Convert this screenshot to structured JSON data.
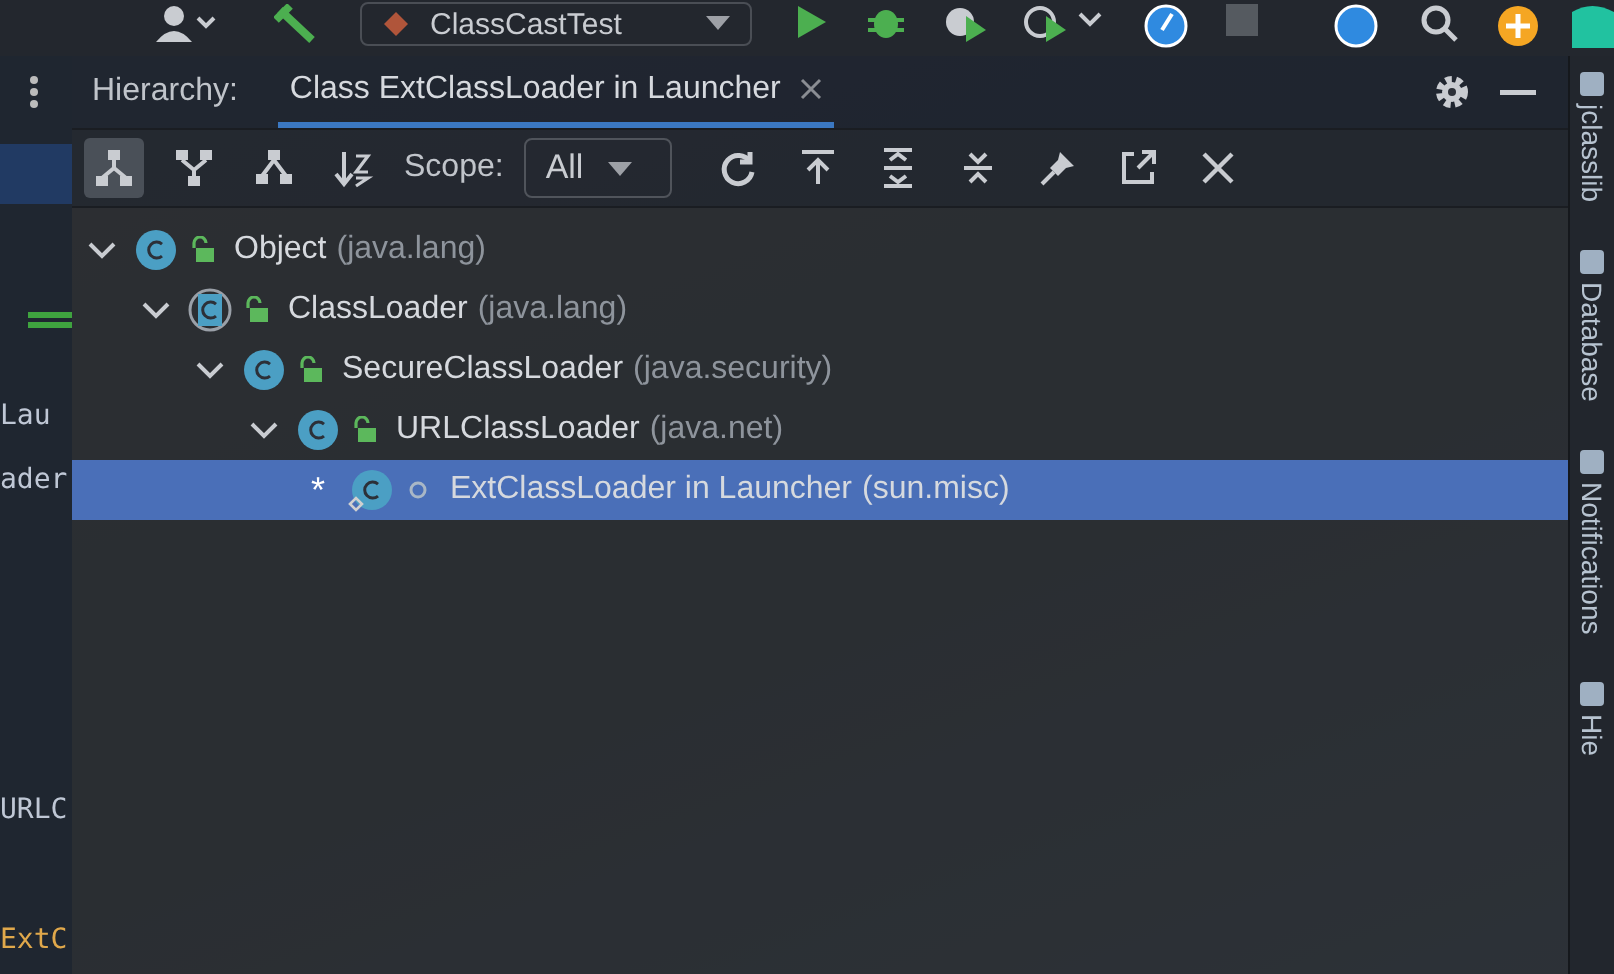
{
  "top_toolbar": {
    "run_config": "ClassCastTest"
  },
  "editor_fragments": [
    {
      "text": "Lau",
      "kind": "plain"
    },
    {
      "text": "ader",
      "kind": "plain"
    },
    {
      "text": "URLC",
      "kind": "plain"
    },
    {
      "text": "ExtC",
      "kind": "type"
    }
  ],
  "tool_window": {
    "title": "Hierarchy:",
    "tabs": [
      {
        "label": "Class ExtClassLoader in Launcher",
        "selected": true
      }
    ],
    "toolbar": {
      "buttons": [
        {
          "kind": "subtypes",
          "selected": true
        },
        {
          "kind": "supertypes",
          "selected": false
        },
        {
          "kind": "class-hierarchy",
          "selected": false
        },
        {
          "kind": "sort",
          "selected": false
        }
      ],
      "scope_label": "Scope:",
      "scope_value": "All",
      "actions": [
        {
          "kind": "refresh"
        },
        {
          "kind": "export"
        },
        {
          "kind": "expand"
        },
        {
          "kind": "collapse"
        },
        {
          "kind": "pin"
        },
        {
          "kind": "open"
        },
        {
          "kind": "close"
        }
      ]
    },
    "tree": [
      {
        "name": "Object",
        "package": "(java.lang)",
        "kind": "class",
        "public": true,
        "expanded": true,
        "selected": false,
        "children": [
          {
            "name": "ClassLoader",
            "package": "(java.lang)",
            "kind": "abstract",
            "public": true,
            "expanded": true,
            "selected": false,
            "children": [
              {
                "name": "SecureClassLoader",
                "package": "(java.security)",
                "kind": "class",
                "public": true,
                "expanded": true,
                "selected": false,
                "children": [
                  {
                    "name": "URLClassLoader",
                    "package": "(java.net)",
                    "kind": "class",
                    "public": true,
                    "expanded": true,
                    "selected": false,
                    "children": [
                      {
                        "name": "ExtClassLoader in Launcher",
                        "package": "(sun.misc)",
                        "kind": "inner",
                        "public": false,
                        "marker": "*",
                        "selected": true
                      }
                    ]
                  }
                ]
              }
            ]
          }
        ]
      }
    ]
  },
  "side_stripe": [
    "jclasslib",
    "Database",
    "Notifications",
    "Hie"
  ]
}
